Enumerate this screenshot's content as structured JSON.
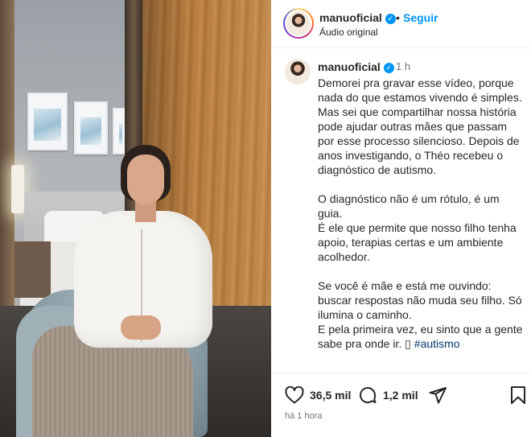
{
  "header": {
    "username": "manuoficial",
    "separator": "•",
    "follow_label": "Seguir",
    "audio_label": "Áudio original"
  },
  "caption": {
    "username": "manuoficial",
    "time": "1 h",
    "text": "Demorei pra gravar esse vídeo, porque nada do que estamos vivendo é simples.\nMas sei que compartilhar nossa história pode ajudar outras mães que passam por esse processo silencioso. Depois de anos investigando, o Théo recebeu o diagnóstico de autismo.\n\nO diagnóstico não é um rótulo, é um guia.\nÉ ele que permite que nosso filho tenha apoio, terapias certas e um ambiente acolhedor.\n\nSe você é mãe e está me ouvindo: buscar respostas não muda seu filho. Só ilumina o caminho.\nE pela primeira vez, eu sinto que a gente sabe pra onde ir. ▯ ",
    "hashtag": "#autismo"
  },
  "actions": {
    "likes": "36,5 mil",
    "comments": "1,2 mil",
    "posted_ago": "há 1 hora"
  },
  "icons": {
    "like": "heart-icon",
    "comment": "comment-bubble-icon",
    "share": "paper-plane-icon",
    "save": "bookmark-icon",
    "verified": "verified-badge-icon"
  },
  "colors": {
    "link_blue": "#0095f6",
    "hashtag": "#00376b",
    "verified": "#0095f6"
  }
}
